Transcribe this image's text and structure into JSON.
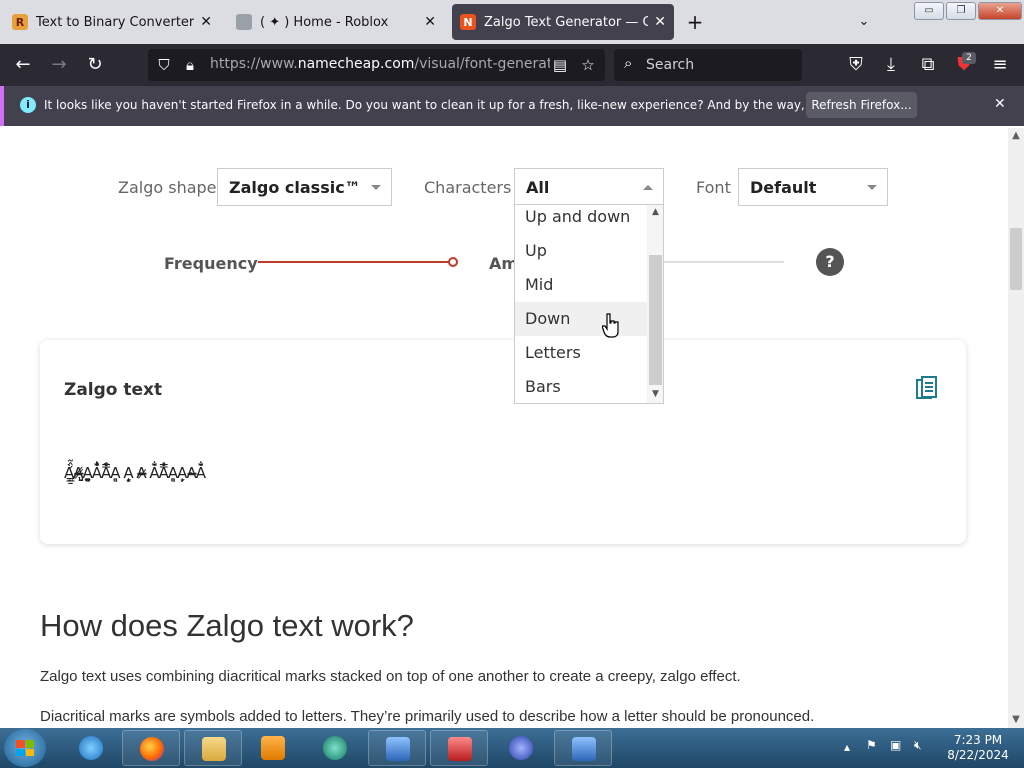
{
  "browser": {
    "tabs": [
      {
        "title": "Text to Binary Converter",
        "favicon_color": "#e8a13a"
      },
      {
        "title": "( ✦ ) Home - Roblox",
        "favicon_color": "#9aa0a8"
      },
      {
        "title": "Zalgo Text Generator — Copy a",
        "favicon_color": "#e8541e"
      }
    ],
    "url_prefix": "https://www.",
    "url_domain": "namecheap.com",
    "url_path": "/visual/font-generator/zal",
    "search_placeholder": "Search",
    "extensions_badge": "2",
    "notification": {
      "message": "It looks like you haven't started Firefox in a while. Do you want to clean it up for a fresh, like-new experience? And by the way, welcome back!",
      "button": "Refresh Firefox..."
    }
  },
  "controls": {
    "shape_label": "Zalgo shape",
    "shape_value": "Zalgo classic™",
    "characters_label": "Characters",
    "characters_value": "All",
    "font_label": "Font",
    "font_value": "Default",
    "frequency_label": "Frequency",
    "amount_label": "Am",
    "help": "?",
    "frequency_level": 1.0
  },
  "dropdown": {
    "options": [
      "Up and down",
      "Up",
      "Mid",
      "Down",
      "Letters",
      "Bars"
    ],
    "hovered": "Down"
  },
  "card": {
    "title": "Zalgo text",
    "zalgo_text": "À̰̱̲̳́̂̃A̴̵̶̷̸̡̢A͇͈͉͍͎A̐̑̒̓̔A̽̾̿̀́A͇͈͉ A̦̗̘̙̜̝ A̴̵̶̷ A̐̑̒A̽̾̿A͇͈͉A̦̗̘A̴̵̶A̐̑̒"
  },
  "article": {
    "heading": "How does Zalgo text work?",
    "p1": "Zalgo text uses combining diacritical marks stacked on top of one another to create a creepy, zalgo effect.",
    "p2": "Diacritical marks are symbols added to letters. They’re primarily used to describe how a letter should be pronounced."
  },
  "taskbar": {
    "time": "7:23 PM",
    "date": "8/22/2024"
  },
  "colors": {
    "accent_red": "#c0392b",
    "copy_icon": "#1f7a8c",
    "notif_accent": "#d270f5"
  }
}
